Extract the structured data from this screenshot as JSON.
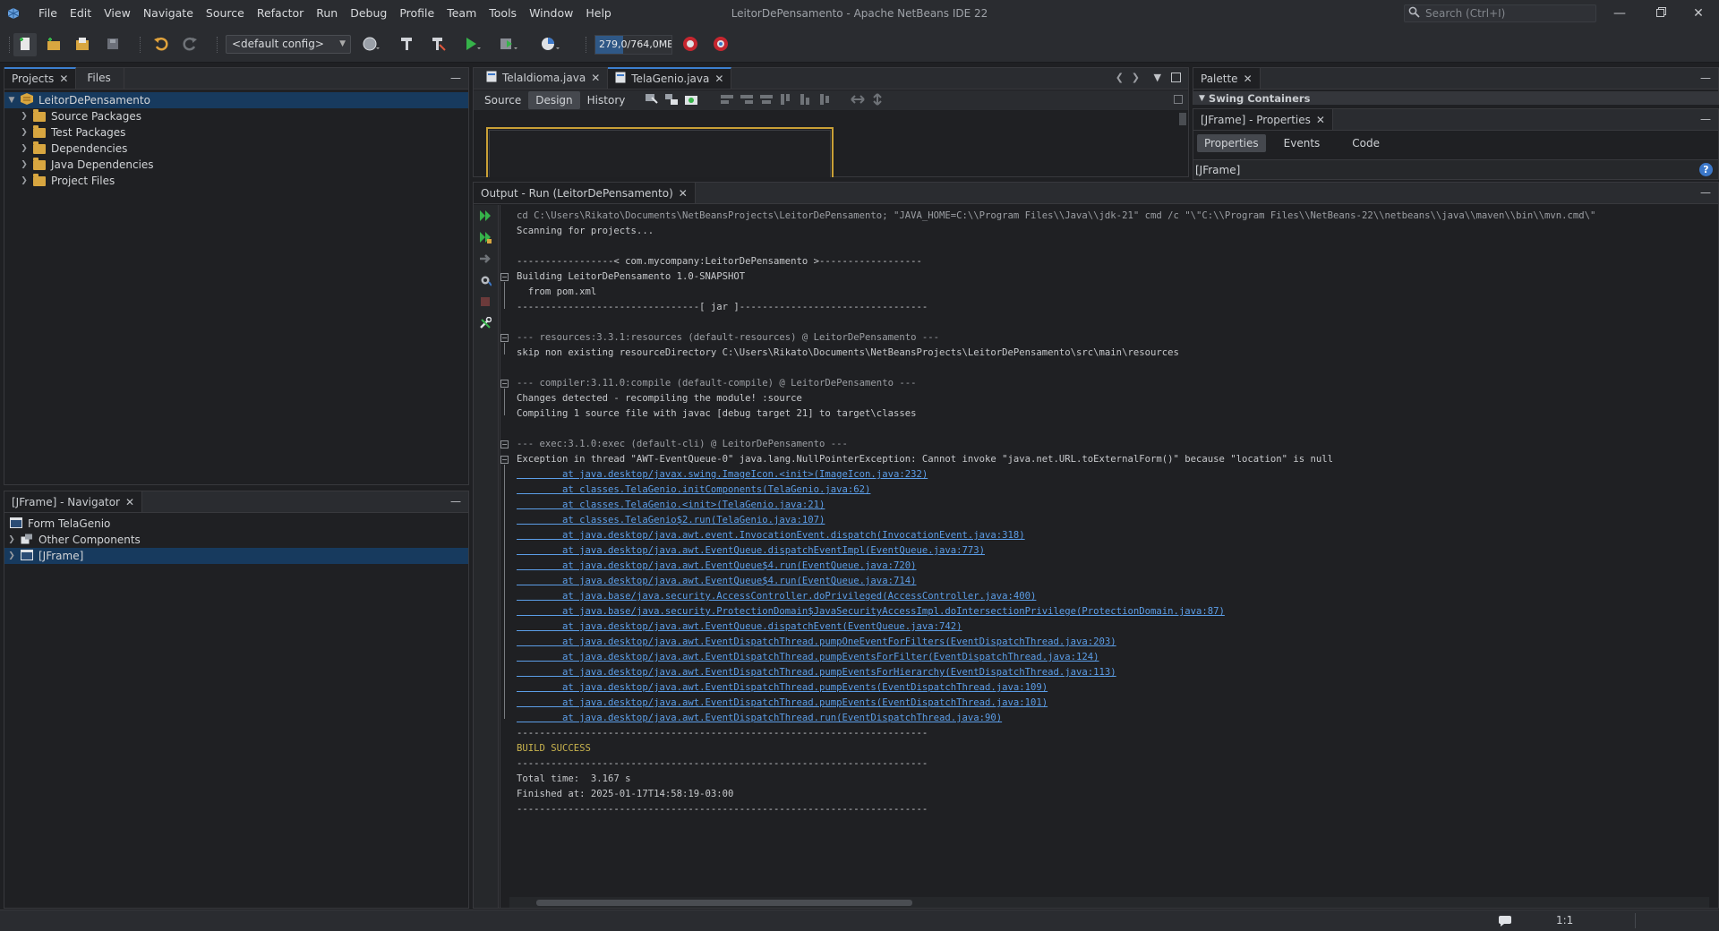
{
  "window": {
    "title": "LeitorDePensamento - Apache NetBeans IDE 22",
    "menu": [
      "File",
      "Edit",
      "View",
      "Navigate",
      "Source",
      "Refactor",
      "Run",
      "Debug",
      "Profile",
      "Team",
      "Tools",
      "Window",
      "Help"
    ],
    "search_placeholder": "Search (Ctrl+I)"
  },
  "toolbar": {
    "config": "<default config>",
    "memory": "279,0/764,0MB",
    "memory_fraction": 0.365
  },
  "projects": {
    "tabs": [
      "Projects",
      "Files"
    ],
    "root": "LeitorDePensamento",
    "items": [
      "Source Packages",
      "Test Packages",
      "Dependencies",
      "Java Dependencies",
      "Project Files"
    ]
  },
  "navigator": {
    "tab": "[JFrame] - Navigator",
    "form": "Form TelaGenio",
    "items": [
      "Other Components",
      "[JFrame]"
    ]
  },
  "editor": {
    "tabs": [
      "TelaIdioma.java",
      "TelaGenio.java"
    ],
    "subtabs": [
      "Source",
      "Design",
      "History"
    ]
  },
  "output": {
    "tab": "Output - Run (LeitorDePensamento)",
    "lines": [
      {
        "t": "cd C:\\Users\\Rikato\\Documents\\NetBeansProjects\\LeitorDePensamento; \"JAVA_HOME=C:\\\\Program Files\\\\Java\\\\jdk-21\" cmd /c \"\\\"C:\\\\Program Files\\\\NetBeans-22\\\\netbeans\\\\java\\\\maven\\\\bin\\\\mvn.cmd\\\"",
        "k": "dim"
      },
      {
        "t": "Scanning for projects...",
        "k": ""
      },
      {
        "t": "",
        "k": ""
      },
      {
        "t": "-----------------< com.mycompany:LeitorDePensamento >------------------",
        "k": ""
      },
      {
        "t": "Building LeitorDePensamento 1.0-SNAPSHOT",
        "k": ""
      },
      {
        "t": "  from pom.xml",
        "k": ""
      },
      {
        "t": "--------------------------------[ jar ]---------------------------------",
        "k": ""
      },
      {
        "t": "",
        "k": ""
      },
      {
        "t": "--- resources:3.3.1:resources (default-resources) @ LeitorDePensamento ---",
        "k": "dim"
      },
      {
        "t": "skip non existing resourceDirectory C:\\Users\\Rikato\\Documents\\NetBeansProjects\\LeitorDePensamento\\src\\main\\resources",
        "k": ""
      },
      {
        "t": "",
        "k": ""
      },
      {
        "t": "--- compiler:3.11.0:compile (default-compile) @ LeitorDePensamento ---",
        "k": "dim"
      },
      {
        "t": "Changes detected - recompiling the module! :source",
        "k": ""
      },
      {
        "t": "Compiling 1 source file with javac [debug target 21] to target\\classes",
        "k": ""
      },
      {
        "t": "",
        "k": ""
      },
      {
        "t": "--- exec:3.1.0:exec (default-cli) @ LeitorDePensamento ---",
        "k": "dim"
      },
      {
        "t": "Exception in thread \"AWT-EventQueue-0\" java.lang.NullPointerException: Cannot invoke \"java.net.URL.toExternalForm()\" because \"location\" is null",
        "k": ""
      },
      {
        "t": "        at java.desktop/javax.swing.ImageIcon.<init>(ImageIcon.java:232)",
        "k": "link"
      },
      {
        "t": "        at classes.TelaGenio.initComponents(TelaGenio.java:62)",
        "k": "link"
      },
      {
        "t": "        at classes.TelaGenio.<init>(TelaGenio.java:21)",
        "k": "link"
      },
      {
        "t": "        at classes.TelaGenio$2.run(TelaGenio.java:107)",
        "k": "link"
      },
      {
        "t": "        at java.desktop/java.awt.event.InvocationEvent.dispatch(InvocationEvent.java:318)",
        "k": "link"
      },
      {
        "t": "        at java.desktop/java.awt.EventQueue.dispatchEventImpl(EventQueue.java:773)",
        "k": "link"
      },
      {
        "t": "        at java.desktop/java.awt.EventQueue$4.run(EventQueue.java:720)",
        "k": "link"
      },
      {
        "t": "        at java.desktop/java.awt.EventQueue$4.run(EventQueue.java:714)",
        "k": "link"
      },
      {
        "t": "        at java.base/java.security.AccessController.doPrivileged(AccessController.java:400)",
        "k": "link"
      },
      {
        "t": "        at java.base/java.security.ProtectionDomain$JavaSecurityAccessImpl.doIntersectionPrivilege(ProtectionDomain.java:87)",
        "k": "link"
      },
      {
        "t": "        at java.desktop/java.awt.EventQueue.dispatchEvent(EventQueue.java:742)",
        "k": "link"
      },
      {
        "t": "        at java.desktop/java.awt.EventDispatchThread.pumpOneEventForFilters(EventDispatchThread.java:203)",
        "k": "link"
      },
      {
        "t": "        at java.desktop/java.awt.EventDispatchThread.pumpEventsForFilter(EventDispatchThread.java:124)",
        "k": "link"
      },
      {
        "t": "        at java.desktop/java.awt.EventDispatchThread.pumpEventsForHierarchy(EventDispatchThread.java:113)",
        "k": "link"
      },
      {
        "t": "        at java.desktop/java.awt.EventDispatchThread.pumpEvents(EventDispatchThread.java:109)",
        "k": "link"
      },
      {
        "t": "        at java.desktop/java.awt.EventDispatchThread.pumpEvents(EventDispatchThread.java:101)",
        "k": "link"
      },
      {
        "t": "        at java.desktop/java.awt.EventDispatchThread.run(EventDispatchThread.java:90)",
        "k": "link"
      },
      {
        "t": "------------------------------------------------------------------------",
        "k": ""
      },
      {
        "t": "BUILD SUCCESS",
        "k": "succ"
      },
      {
        "t": "------------------------------------------------------------------------",
        "k": ""
      },
      {
        "t": "Total time:  3.167 s",
        "k": ""
      },
      {
        "t": "Finished at: 2025-01-17T14:58:19-03:00",
        "k": ""
      },
      {
        "t": "------------------------------------------------------------------------",
        "k": ""
      }
    ]
  },
  "palette": {
    "tab": "Palette",
    "section": "Swing Containers"
  },
  "properties": {
    "tab": "[JFrame] - Properties",
    "subtabs": [
      "Properties",
      "Events",
      "Code"
    ],
    "object": "[JFrame]"
  },
  "status": {
    "position": "1:1"
  },
  "colors": {
    "accent": "#3c7fcf",
    "link": "#5c9ee8",
    "success": "#c8b34e"
  }
}
